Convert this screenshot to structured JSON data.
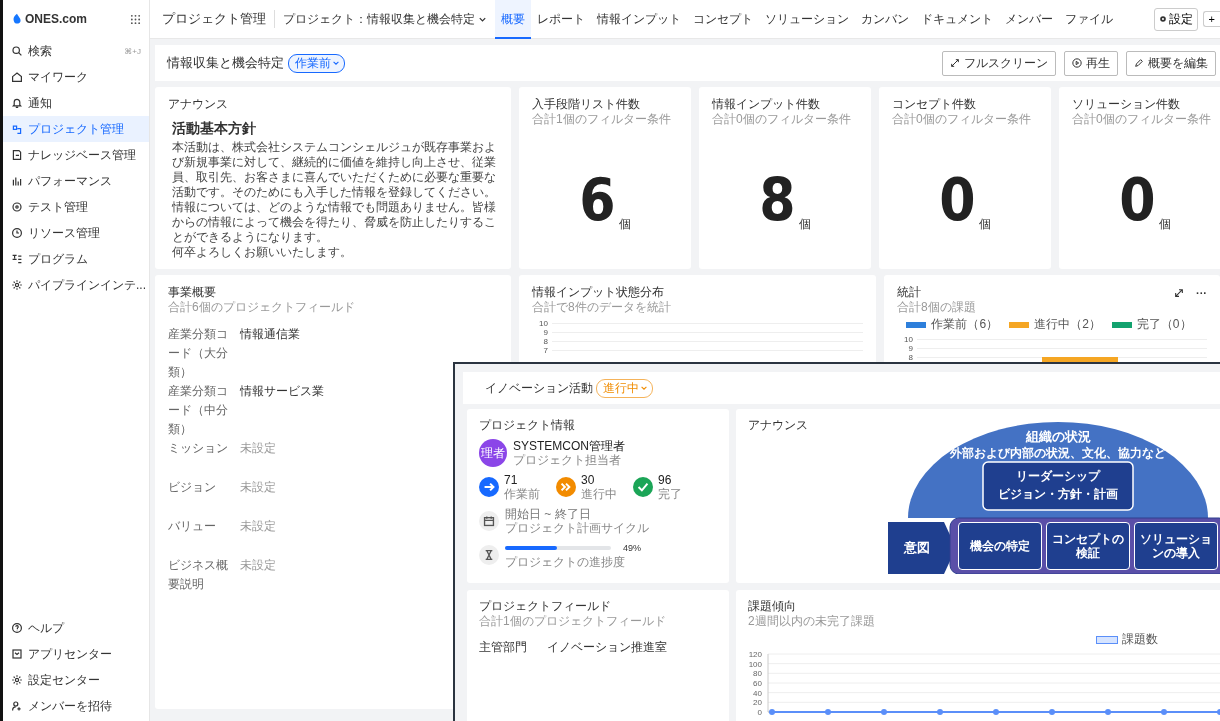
{
  "logo": "ONES.com",
  "sidebar": {
    "items": [
      {
        "label": "検索",
        "shortcut": "⌘+J",
        "selected": false
      },
      {
        "label": "マイワーク",
        "selected": false
      },
      {
        "label": "通知",
        "selected": false
      },
      {
        "label": "プロジェクト管理",
        "selected": true
      },
      {
        "label": "ナレッジベース管理",
        "selected": false
      },
      {
        "label": "パフォーマンス",
        "selected": false
      },
      {
        "label": "テスト管理",
        "selected": false
      },
      {
        "label": "リソース管理",
        "selected": false
      },
      {
        "label": "プログラム",
        "selected": false
      },
      {
        "label": "パイプラインインテ...",
        "selected": false
      }
    ],
    "bottom_items": [
      {
        "label": "ヘルプ"
      },
      {
        "label": "アプリセンター"
      },
      {
        "label": "設定センター"
      },
      {
        "label": "メンバーを招待"
      }
    ]
  },
  "topbar": {
    "title": "プロジェクト管理",
    "project": "プロジェクト：情報収集と機会特定",
    "tabs": [
      {
        "label": "概要",
        "selected": true
      },
      {
        "label": "レポート",
        "selected": false
      },
      {
        "label": "情報インプット",
        "selected": false
      },
      {
        "label": "コンセプト",
        "selected": false
      },
      {
        "label": "ソリューション",
        "selected": false
      },
      {
        "label": "カンバン",
        "selected": false
      },
      {
        "label": "ドキュメント",
        "selected": false
      },
      {
        "label": "メンバー",
        "selected": false
      },
      {
        "label": "ファイル",
        "selected": false
      }
    ],
    "settings_button": "設定",
    "plus_button": "+"
  },
  "header": {
    "title": "情報収集と機会特定",
    "status": "作業前",
    "buttons": [
      {
        "label": "フルスクリーン",
        "kind": "expand"
      },
      {
        "label": "再生",
        "kind": "play"
      },
      {
        "label": "概要を編集",
        "kind": "edit"
      }
    ]
  },
  "announcement": {
    "title": "アナウンス",
    "heading": "活動基本方針",
    "paragraphs": [
      "本活動は、株式会社システムコンシェルジュが既存事業および新規事業に対して、継続的に価値を維持し向上させ、従業員、取引先、お客さまに喜んでいただくために必要な重要な活動です。そのためにも入手した情報を登録してください。",
      "情報については、どのような情報でも問題ありません。皆様からの情報によって機会を得たり、脅威を防止したりすることができるようになります。",
      "何卒よろしくお願いいたします。"
    ]
  },
  "stat_cards": [
    {
      "title": "入手段階リスト件数",
      "subtitle": "合計1個のフィルター条件",
      "value": "6",
      "unit": "個"
    },
    {
      "title": "情報インプット件数",
      "subtitle": "合計0個のフィルター条件",
      "value": "8",
      "unit": "個"
    },
    {
      "title": "コンセプト件数",
      "subtitle": "合計0個のフィルター条件",
      "value": "0",
      "unit": "個"
    },
    {
      "title": "ソリューション件数",
      "subtitle": "合計0個のフィルター条件",
      "value": "0",
      "unit": "個"
    }
  ],
  "business_overview": {
    "title": "事業概要",
    "subtitle": "合計6個のプロジェクトフィールド",
    "fields": [
      {
        "label": "産業分類コード（大分類）",
        "value": "情報通信業",
        "empty": false
      },
      {
        "label": "産業分類コード（中分類）",
        "value": "情報サービス業",
        "empty": false
      },
      {
        "label": "ミッション",
        "value": "未設定",
        "empty": true
      },
      {
        "label": "ビジョン",
        "value": "未設定",
        "empty": true
      },
      {
        "label": "バリュー",
        "value": "未設定",
        "empty": true
      },
      {
        "label": "ビジネス概要説明",
        "value": "未設定",
        "empty": true
      }
    ]
  },
  "input_distribution": {
    "title": "情報インプット状態分布",
    "subtitle": "合計で8件のデータを統計",
    "axis_labels": [
      "10",
      "9",
      "8",
      "7"
    ]
  },
  "statistics": {
    "title": "統計",
    "subtitle": "合計8個の課題",
    "legend": [
      {
        "label": "作業前（6）",
        "color": "#2e7fdb"
      },
      {
        "label": "進行中（2）",
        "color": "#f5a623"
      },
      {
        "label": "完了（0）",
        "color": "#12a26e"
      }
    ],
    "axis_labels": [
      "10",
      "9",
      "8"
    ],
    "more_button": "···"
  },
  "inset": {
    "title": "イノベーション活動",
    "status": "進行中",
    "project_info": {
      "title": "プロジェクト情報",
      "avatar": "理者",
      "owner": "SYSTEMCON管理者",
      "role": "プロジェクト担当者",
      "counts": [
        {
          "kind": "todo",
          "value": "71",
          "label": "作業前",
          "color": "#1769ff"
        },
        {
          "kind": "doing",
          "value": "30",
          "label": "進行中",
          "color": "#f28b00"
        },
        {
          "kind": "done",
          "value": "96",
          "label": "完了",
          "color": "#1ba557"
        }
      ],
      "dates": "開始日 ~ 終了日",
      "cycle": "プロジェクト計画サイクル",
      "progress": {
        "level": 0.49,
        "reading": "49%",
        "label": "プロジェクトの進捗度"
      }
    },
    "announcement": {
      "title": "アナウンス",
      "diagram": {
        "top": "組織の状況",
        "top_sub": "外部および内部の状況、文化、協力など",
        "leader": "リーダーシップ",
        "leader_sub": "ビジョン・方針・計画",
        "intent": "意図",
        "steps": [
          "機会の特定",
          "コンセプトの検証",
          "ソリューションの導入"
        ]
      }
    },
    "project_fields": {
      "title": "プロジェクトフィールド",
      "subtitle": "合計1個のプロジェクトフィールド",
      "fields": [
        {
          "label": "主管部門",
          "value": "イノベーション推進室"
        }
      ]
    },
    "issue_trend": {
      "title": "課題傾向",
      "subtitle": "2週間以内の未完了課題",
      "chart_data": {
        "type": "line",
        "series": [
          {
            "name": "課題数",
            "color": "#5b8ff9",
            "marker": "circle",
            "values": [
              0,
              0,
              0,
              0,
              0,
              0,
              0,
              0,
              0
            ]
          }
        ],
        "grid": true,
        "ylim": [
          0,
          120
        ],
        "yticks": [
          0,
          20,
          40,
          60,
          80,
          100,
          120
        ]
      }
    }
  }
}
